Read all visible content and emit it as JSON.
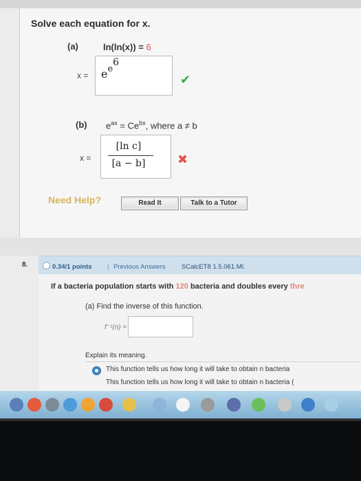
{
  "problem1": {
    "instruction": "Solve each equation for x.",
    "part_a": {
      "label": "(a)",
      "equation": "ln(ln(x)) = ",
      "equation_rhs": "6",
      "x_label": "x =",
      "answer_base": "e",
      "answer_exp_base": "e",
      "answer_exp_exp": "6",
      "status": "correct"
    },
    "part_b": {
      "label": "(b)",
      "lhs_base": "e",
      "lhs_exp": "ax",
      "eq": " = ",
      "rhs_base": "Ce",
      "rhs_exp": "bx",
      "condition": ", where a ≠ b",
      "x_label": "x =",
      "numerator": "[ln c]",
      "denominator": "[a − b]",
      "status": "incorrect"
    },
    "help": {
      "label": "Need Help?",
      "read_it": "Read It",
      "talk_to_tutor": "Talk to a Tutor"
    }
  },
  "problem2": {
    "number": "8.",
    "points": "0.34/1 points",
    "separator": "|",
    "previous_answers": "Previous Answers",
    "source": "SCalcET8 1.5.061.MI.",
    "question_pre": "If a bacteria population starts with ",
    "question_count": "120",
    "question_post": " bacteria and doubles every ",
    "question_cut": "thre",
    "part_a": "(a) Find the inverse of this function.",
    "inverse_label": "f⁻¹(n) =",
    "explain_label": "Explain its meaning.",
    "options": [
      "This function tells us how long it will take to obtain n bacteria",
      "This function tells us how long it will take to obtain n bacteria ("
    ]
  },
  "colors": {
    "correct": "#3aa647",
    "incorrect": "#e2564b",
    "need_help": "#d9b55a",
    "header_bg": "#cfe0ec",
    "link": "#3a6da1"
  }
}
